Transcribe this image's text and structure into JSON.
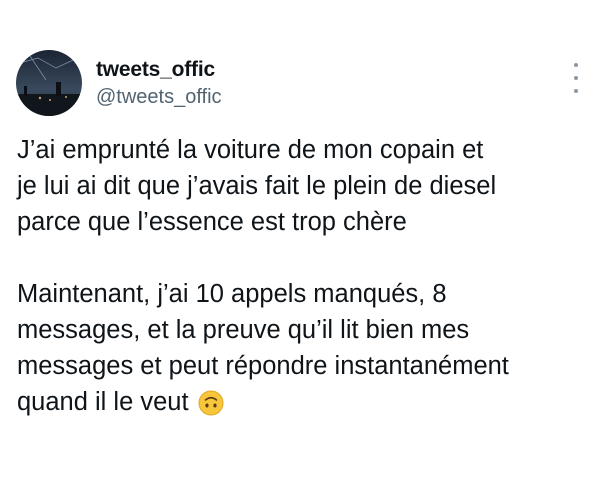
{
  "user": {
    "display_name": "tweets_offic",
    "handle": "@tweets_offic",
    "avatar_icon": "avatar-night-scene"
  },
  "menu": {
    "icon": "more-vertical-icon"
  },
  "tweet": {
    "paragraph1": [
      "J’ai emprunté la voiture de mon copain et",
      "je lui ai dit que j’avais fait le plein de diesel",
      "parce que l’essence est trop chère"
    ],
    "paragraph2": [
      "Maintenant, j’ai 10 appels manqués, 8",
      "messages, et la preuve qu’il lit bien mes",
      "messages et peut répondre instantanément",
      "quand il le veut"
    ],
    "trailing_emoji": "upside-down-face-emoji"
  }
}
